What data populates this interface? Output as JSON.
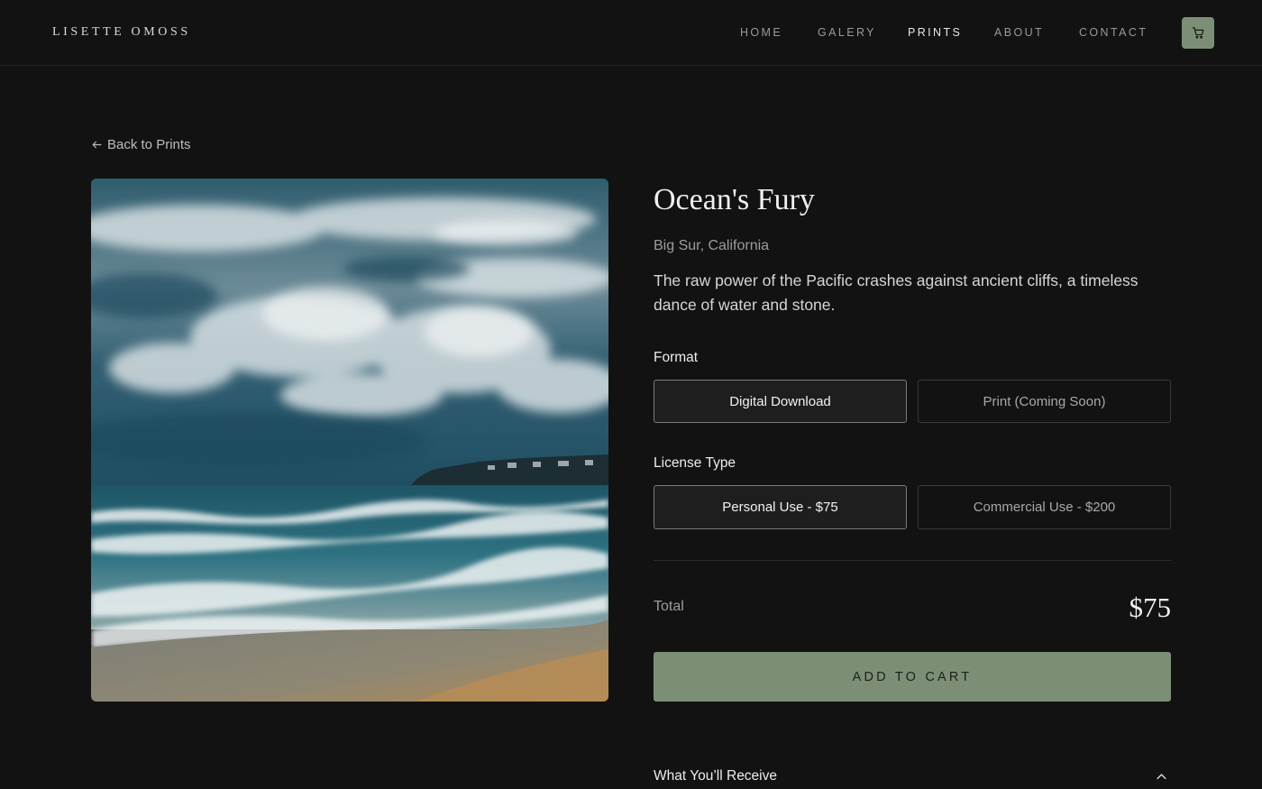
{
  "header": {
    "brand": "LISETTE OMOSS",
    "nav": [
      {
        "label": "HOME"
      },
      {
        "label": "GALERY"
      },
      {
        "label": "PRINTS",
        "active": true
      },
      {
        "label": "ABOUT"
      },
      {
        "label": "CONTACT"
      }
    ],
    "cart_icon": "cart-icon",
    "accent_color": "#7c8f76"
  },
  "back_link": {
    "label": "Back to Prints",
    "icon": "arrow-left-icon"
  },
  "product": {
    "title": "Ocean's Fury",
    "location": "Big Sur, California",
    "description": "The raw power of the Pacific crashes against ancient cliffs, a timeless dance of water and stone.",
    "format": {
      "label": "Format",
      "options": [
        {
          "label": "Digital Download",
          "selected": true
        },
        {
          "label": "Print (Coming Soon)",
          "selected": false
        }
      ]
    },
    "license": {
      "label": "License Type",
      "options": [
        {
          "label": "Personal Use - $75",
          "selected": true
        },
        {
          "label": "Commercial Use - $200",
          "selected": false
        }
      ]
    },
    "total_label": "Total",
    "total_value": "$75",
    "add_to_cart": "ADD TO CART",
    "accordion": {
      "label": "What You’ll Receive",
      "icon": "chevron-up-icon",
      "expanded": true
    }
  }
}
